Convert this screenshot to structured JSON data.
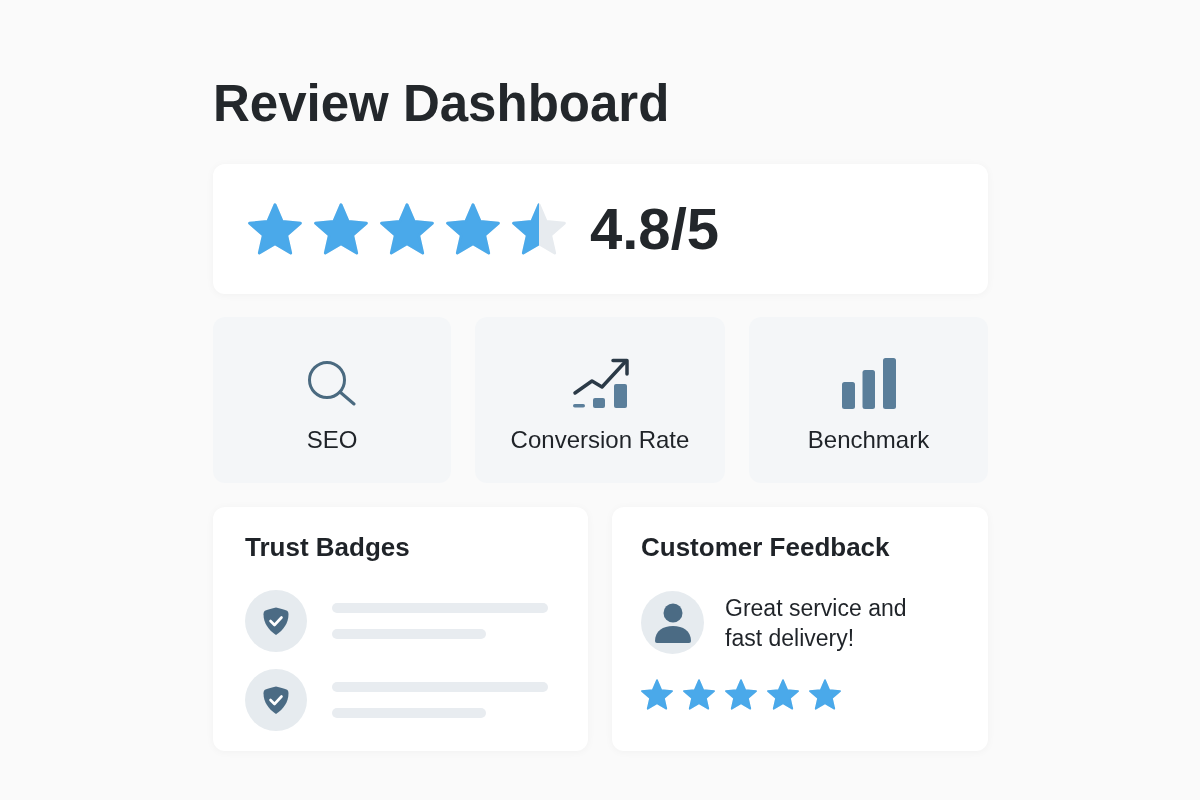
{
  "title": "Review Dashboard",
  "rating": {
    "stars": 4.5,
    "value": "4.8/5"
  },
  "metrics": [
    {
      "kind": "search",
      "label": "SEO"
    },
    {
      "kind": "trend",
      "label": "Conversion Rate"
    },
    {
      "kind": "bars",
      "label": "Benchmark"
    }
  ],
  "trust_badges": {
    "title": "Trust Badges",
    "badges": [
      {
        "kind": "verified"
      },
      {
        "kind": "verified"
      }
    ]
  },
  "feedback": {
    "title": "Customer Feedback",
    "comment": "Great service and fast delivery!",
    "stars": 5
  }
}
